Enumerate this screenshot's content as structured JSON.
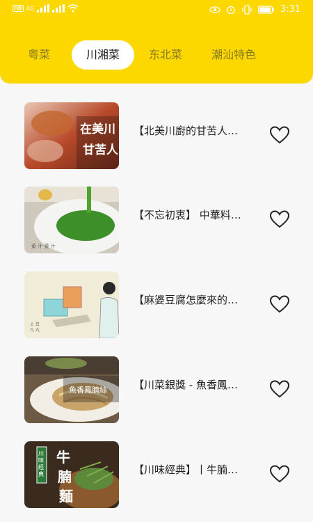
{
  "status_bar": {
    "left_badges": [
      "HD",
      "HD"
    ],
    "network": "4G",
    "time": "3:31"
  },
  "tabs": [
    {
      "label": "粤菜",
      "active": false
    },
    {
      "label": "川湘菜",
      "active": true
    },
    {
      "label": "东北菜",
      "active": false
    },
    {
      "label": "潮汕特色",
      "active": false
    }
  ],
  "videos": [
    {
      "title": "【北美川廚的甘苦人…",
      "thumb_text": "在美川 甘苦人",
      "favorite": false
    },
    {
      "title": "【不忘初衷】 中華料…",
      "thumb_text": "",
      "favorite": false
    },
    {
      "title": "【麻婆豆腐怎麼來的…",
      "thumb_text": "",
      "favorite": false
    },
    {
      "title": "【川菜銀獎 - 魚香鳳…",
      "thumb_text": "魚香鳳腩絲",
      "favorite": false
    },
    {
      "title": "【川味經典】丨牛腩…",
      "thumb_text": "牛腩麵",
      "favorite": false
    }
  ],
  "colors": {
    "header": "#fcd800",
    "background": "#f7f7f7"
  },
  "icons": {
    "favorite": "heart-outline-icon"
  }
}
